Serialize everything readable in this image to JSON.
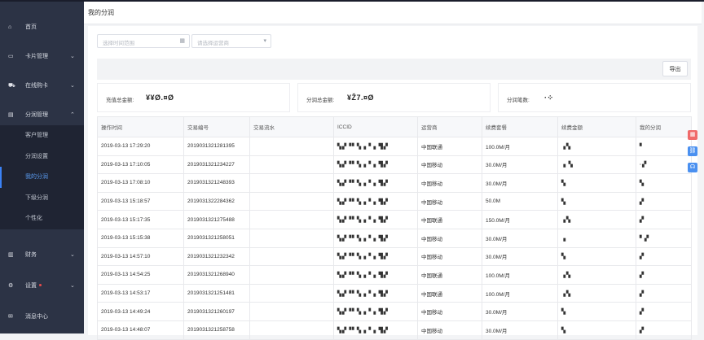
{
  "sidebar": {
    "items": [
      {
        "icon": "home-icon",
        "glyph": "⌂",
        "label": "首页",
        "chev": ""
      },
      {
        "icon": "card-icon",
        "glyph": "▭",
        "label": "卡片管理",
        "chev": "⌄"
      },
      {
        "icon": "cart-icon",
        "glyph": "⛟",
        "label": "在线购卡",
        "chev": "⌄"
      },
      {
        "icon": "split-icon",
        "glyph": "▤",
        "label": "分润管理",
        "chev": "⌃"
      }
    ],
    "sub_items": [
      {
        "label": "客户管理"
      },
      {
        "label": "分润设置"
      },
      {
        "label": "我的分润"
      },
      {
        "label": "下级分润"
      },
      {
        "label": "个性化"
      }
    ],
    "bottom_items": [
      {
        "icon": "finance-icon",
        "glyph": "▥",
        "label": "财务",
        "chev": "⌄"
      },
      {
        "icon": "settings-icon",
        "glyph": "⚙",
        "label": "设置",
        "chev": "⌄"
      },
      {
        "icon": "message-icon",
        "glyph": "✉",
        "label": "消息中心",
        "chev": ""
      }
    ]
  },
  "header": {
    "title": "我的分润"
  },
  "filters": {
    "time_placeholder": "选择时间范围",
    "operator_placeholder": "请选择运营商"
  },
  "toolbar": {
    "export_label": "导出"
  },
  "summary": {
    "recharge_label": "充值总金额:",
    "recharge_value": "¥¥Ø.¤Ø",
    "split_label": "分润总金额:",
    "split_value": "¥Ž7.¤Ø",
    "count_label": "分润笔数:",
    "count_value": "·⁘"
  },
  "table": {
    "headers": [
      "操作时间",
      "交易编号",
      "交易流水",
      "ICCID",
      "运营商",
      "续费套餐",
      "续费金额",
      "我的分润"
    ],
    "rows": [
      [
        "2019-03-13 17:29:20",
        "2019031321281395",
        "",
        "▚▞▝▘▚▗▝▗ ▜▞",
        "中国联通",
        "100.0M/月",
        "▗▚",
        "▘"
      ],
      [
        "2019-03-13 17:10:05",
        "2019031321234227",
        "",
        "▚▞▝▘▚▗▝▗ ▜▞",
        "中国移动",
        "30.0M/月",
        "▗ ▚",
        "·▞"
      ],
      [
        "2019-03-13 17:08:10",
        "2019031321248393",
        "",
        "▚▞▝▘▚▗▝▗ ▜▞",
        "中国移动",
        "30.0M/月",
        "▚",
        "▚"
      ],
      [
        "2019-03-13 15:18:57",
        "2019031322284362",
        "",
        "▚▞▝▘▚▗▝▗ ▜▞",
        "中国移动",
        "50.0M",
        "▚",
        "▞"
      ],
      [
        "2019-03-13 15:17:35",
        "2019031321275488",
        "",
        "▚▞▝▘▚▗▝▗ ▜▞",
        "中国联通",
        "150.0M/月",
        "▗▚",
        "▞"
      ],
      [
        "2019-03-13 15:15:38",
        "2019031321258051",
        "",
        "▚▞▝▘▚▗▝▗ ▜▞",
        "中国移动",
        "30.0M/月",
        "▗",
        "▘▞"
      ],
      [
        "2019-03-13 14:57:10",
        "2019031321232342",
        "",
        "▚▞▝▘▚▗▝▗ ▜▞",
        "中国移动",
        "30.0M/月",
        "▚",
        "▞"
      ],
      [
        "2019-03-13 14:54:25",
        "2019031321268940",
        "",
        "▚▞▝▘▚▗▝▗ ▜▞",
        "中国联通",
        "100.0M/月",
        "▗▚",
        "▞"
      ],
      [
        "2019-03-13 14:53:17",
        "2019031321251481",
        "",
        "▚▞▝▘▚▗▝▗ ▜▞",
        "中国联通",
        "100.0M/月",
        "▗▚",
        "▞"
      ],
      [
        "2019-03-13 14:49:24",
        "2019031321260197",
        "",
        "▚▞▝▘▚▗▝▗ ▜▞",
        "中国移动",
        "30.0M/月",
        "▚",
        "▞"
      ],
      [
        "2019-03-13 14:48:07",
        "2019031321258758",
        "",
        "▚▞▝▘▚▗▝▗ ▜▞",
        "中国移动",
        "30.0M/月",
        "▚",
        "▞"
      ]
    ]
  },
  "floats": [
    {
      "icon": "grid-icon",
      "glyph": "▦"
    },
    {
      "icon": "link-icon",
      "glyph": "⛓"
    },
    {
      "icon": "headset-icon",
      "glyph": "☊"
    }
  ],
  "colors": {
    "sidebar_bg": "#2c3345",
    "submenu_bg": "#1f2433",
    "active": "#5a9bf0",
    "badge": "#e84b4b"
  }
}
